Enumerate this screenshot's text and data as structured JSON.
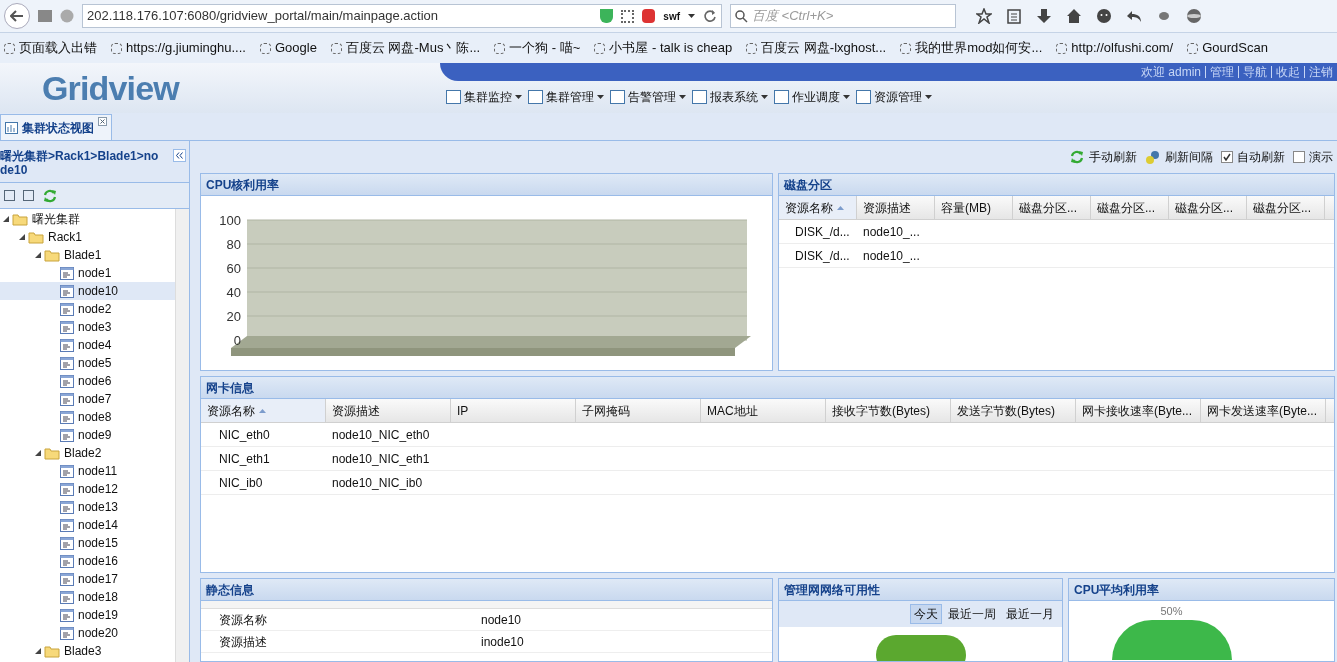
{
  "browser": {
    "url": "202.118.176.107:6080/gridview_portal/main/mainpage.action",
    "addon_label": "swf",
    "search": {
      "placeholder": "百度 <Ctrl+K>"
    },
    "bookmarks": [
      "页面载入出错",
      "https://g.jiuminghu....",
      "Google",
      "百度云 网盘-Mus丶陈...",
      "一个狗 - 喵~",
      "小书屋 - talk is cheap",
      "百度云 网盘-lxghost...",
      "我的世界mod如何安...",
      "http://olfushi.com/",
      "GourdScan"
    ]
  },
  "header": {
    "logo": "Gridview",
    "user_links": [
      "欢迎 admin",
      "管理",
      "导航",
      "收起",
      "注销"
    ],
    "menu": [
      "集群监控",
      "集群管理",
      "告警管理",
      "报表系统",
      "作业调度",
      "资源管理"
    ]
  },
  "tabs": [
    {
      "label": "集群状态视图",
      "selected": true
    }
  ],
  "sidebar": {
    "breadcrumb": "曙光集群>Rack1>Blade1>node10",
    "tree": [
      {
        "label": "曙光集群",
        "kind": "folder",
        "expanded": true,
        "selected": false,
        "children": [
          {
            "label": "Rack1",
            "kind": "folder",
            "expanded": true,
            "selected": false,
            "children": [
              {
                "label": "Blade1",
                "kind": "folder",
                "expanded": true,
                "selected": false,
                "children": [
                  {
                    "label": "node1",
                    "kind": "node",
                    "selected": false
                  },
                  {
                    "label": "node10",
                    "kind": "node",
                    "selected": true
                  },
                  {
                    "label": "node2",
                    "kind": "node",
                    "selected": false
                  },
                  {
                    "label": "node3",
                    "kind": "node",
                    "selected": false
                  },
                  {
                    "label": "node4",
                    "kind": "node",
                    "selected": false
                  },
                  {
                    "label": "node5",
                    "kind": "node",
                    "selected": false
                  },
                  {
                    "label": "node6",
                    "kind": "node",
                    "selected": false
                  },
                  {
                    "label": "node7",
                    "kind": "node",
                    "selected": false
                  },
                  {
                    "label": "node8",
                    "kind": "node",
                    "selected": false
                  },
                  {
                    "label": "node9",
                    "kind": "node",
                    "selected": false
                  }
                ]
              },
              {
                "label": "Blade2",
                "kind": "folder",
                "expanded": true,
                "selected": false,
                "children": [
                  {
                    "label": "node11",
                    "kind": "node",
                    "selected": false
                  },
                  {
                    "label": "node12",
                    "kind": "node",
                    "selected": false
                  },
                  {
                    "label": "node13",
                    "kind": "node",
                    "selected": false
                  },
                  {
                    "label": "node14",
                    "kind": "node",
                    "selected": false
                  },
                  {
                    "label": "node15",
                    "kind": "node",
                    "selected": false
                  },
                  {
                    "label": "node16",
                    "kind": "node",
                    "selected": false
                  },
                  {
                    "label": "node17",
                    "kind": "node",
                    "selected": false
                  },
                  {
                    "label": "node18",
                    "kind": "node",
                    "selected": false
                  },
                  {
                    "label": "node19",
                    "kind": "node",
                    "selected": false
                  },
                  {
                    "label": "node20",
                    "kind": "node",
                    "selected": false
                  }
                ]
              },
              {
                "label": "Blade3",
                "kind": "folder",
                "expanded": true,
                "selected": false
              }
            ]
          }
        ]
      }
    ]
  },
  "toolbar": {
    "refresh": "手动刷新",
    "interval": "刷新间隔",
    "checks": [
      {
        "label": "自动刷新",
        "checked": true
      },
      {
        "label": "演示",
        "checked": false
      }
    ]
  },
  "cpu_core": {
    "title": "CPU核利用率",
    "axis_labels": [
      "100",
      "80",
      "60",
      "40",
      "20",
      "0"
    ]
  },
  "disk": {
    "title": "磁盘分区",
    "columns": [
      "资源名称",
      "资源描述",
      "容量(MB)",
      "磁盘分区...",
      "磁盘分区...",
      "磁盘分区...",
      "磁盘分区..."
    ],
    "rows": [
      [
        "DISK_/d...",
        "node10_..."
      ],
      [
        "DISK_/d...",
        "node10_..."
      ]
    ]
  },
  "nic": {
    "title": "网卡信息",
    "columns": [
      "资源名称",
      "资源描述",
      "IP",
      "子网掩码",
      "MAC地址",
      "接收字节数(Bytes)",
      "发送字节数(Bytes)",
      "网卡接收速率(Byte...",
      "网卡发送速率(Byte..."
    ],
    "rows": [
      [
        "NIC_eth0",
        "node10_NIC_eth0"
      ],
      [
        "NIC_eth1",
        "node10_NIC_eth1"
      ],
      [
        "NIC_ib0",
        "node10_NIC_ib0"
      ]
    ]
  },
  "static": {
    "title": "静态信息",
    "rows": [
      [
        "资源名称",
        "node10"
      ],
      [
        "资源描述",
        "inode10"
      ]
    ]
  },
  "network": {
    "title": "管理网网络可用性",
    "ranges": [
      {
        "label": "今天",
        "selected": true
      },
      {
        "label": "最近一周",
        "selected": false
      },
      {
        "label": "最近一月",
        "selected": false
      }
    ]
  },
  "cpu_avg": {
    "title": "CPU平均利用率",
    "gauge_label": "50%"
  }
}
